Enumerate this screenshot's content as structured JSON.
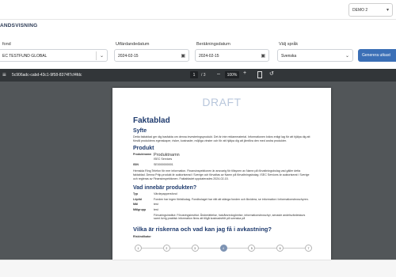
{
  "header": {
    "demo_select": "DEMO 2",
    "section_title": "ANDSVISNING"
  },
  "filters": {
    "fund_label": "fond",
    "fund_value": "EC TESTFUND GLOBAL",
    "issue_date_label": "Utfärdandedatum",
    "issue_date_value": "2024-02-15",
    "calc_date_label": "Beräkningsdatum",
    "calc_date_value": "2024-02-15",
    "language_label": "Välj språk",
    "language_value": "Svenska",
    "generate_label": "Generera utkast"
  },
  "viewer": {
    "file_name": "5c906adc-cabd-43c1-9f58-8374f7cf4fdc",
    "page_current": "1",
    "page_total": "/ 3",
    "zoom": "100%",
    "document": {
      "watermark": "DRAFT",
      "title": "Faktablad",
      "syfte_heading": "Syfte",
      "syfte_text": "Detta faktablad ger dig basfakta om denna investeringsprodukt. Det är inte reklammaterial. Informationen krävs enligt lag för att hjälpa dig att förstå produktens egenskaper, risker, kostnader, möjliga vinster och för att hjälpa dig att jämföra den med andra produkter.",
      "produkt_heading": "Produkt",
      "rows": [
        {
          "key": "Produktnamn",
          "value": "Produktnamn",
          "sub": "ISEC Services"
        },
        {
          "key": "ISIN",
          "value": "SE0000000001",
          "sub": ""
        }
      ],
      "produkt_text": "Hemsida Ring Telefon för mer information. Finansinspektionen är ansvarig för tillsynen av Namn på förvaltningsbolag vad gäller detta faktablad. Denna Priip-produkt är auktoriserad i Sverige och förvaltas av Namn på förvaltningsbolag. ISEC Services är auktoriserat i Sverige och regleras av Finansinspektionen. Faktabladet uppdaterades 2024-02-15.",
      "vad_heading": "Vad innebär produkten?",
      "vad_rows": [
        {
          "key": "Typ",
          "value": "Värdepappersfond"
        },
        {
          "key": "Löptid",
          "value": "Fonden har ingen förfallodag. Fondbolaget har rätt att stänga fonden och likvidera, se information i informationsbroschyren."
        },
        {
          "key": "Mål",
          "value": "test"
        },
        {
          "key": "Målgrupp",
          "value": "test"
        },
        {
          "key": "",
          "value": "Förvaringsinstitut: Förvaringsinstitut. Årsberättelse, halvårsredogörelse, informationsbroschyr, senaste andelsvärdeskurs samt övrig praktisk information finns att tillgå kostnadsfritt på svenska på"
        }
      ],
      "risk_heading": "Vilka är riskerna och vad kan jag få i avkastning?",
      "risk_label": "Riskindikator",
      "risk_scale": [
        "1",
        "2",
        "3",
        "4",
        "5",
        "6",
        "7"
      ],
      "risk_selected": 4
    }
  }
}
